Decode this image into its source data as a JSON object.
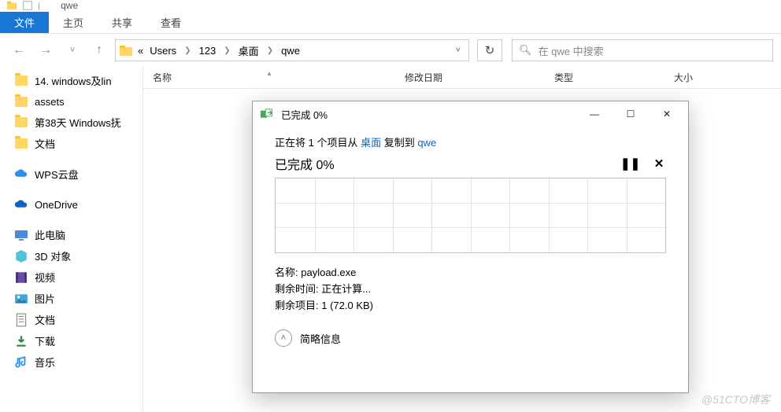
{
  "window": {
    "title": "qwe"
  },
  "ribbon": {
    "file": "文件",
    "home": "主页",
    "share": "共享",
    "view": "查看"
  },
  "breadcrumb": {
    "prefix": "«",
    "parts": [
      "Users",
      "123",
      "桌面",
      "qwe"
    ]
  },
  "search": {
    "placeholder": "在 qwe 中搜索"
  },
  "columns": {
    "name": "名称",
    "date": "修改日期",
    "type": "类型",
    "size": "大小"
  },
  "sidebar": {
    "quick": [
      "14. windows及lin",
      "assets",
      "第38天 Windows抚",
      "文档"
    ],
    "wps": "WPS云盘",
    "onedrive": "OneDrive",
    "thispc": "此电脑",
    "pc_children": [
      "3D 对象",
      "视频",
      "图片",
      "文档",
      "下载",
      "音乐"
    ]
  },
  "dialog": {
    "title": "已完成 0%",
    "copy_prefix": "正在将 1 个项目从 ",
    "copy_src": "桌面",
    "copy_mid": " 复制到 ",
    "copy_dst": "qwe",
    "progress": "已完成 0%",
    "name_label": "名称: ",
    "name_value": "payload.exe",
    "time_label": "剩余时间: ",
    "time_value": "正在计算...",
    "items_label": "剩余项目: ",
    "items_value": "1 (72.0 KB)",
    "fewer": "简略信息"
  },
  "watermark": "@51CTO博客"
}
